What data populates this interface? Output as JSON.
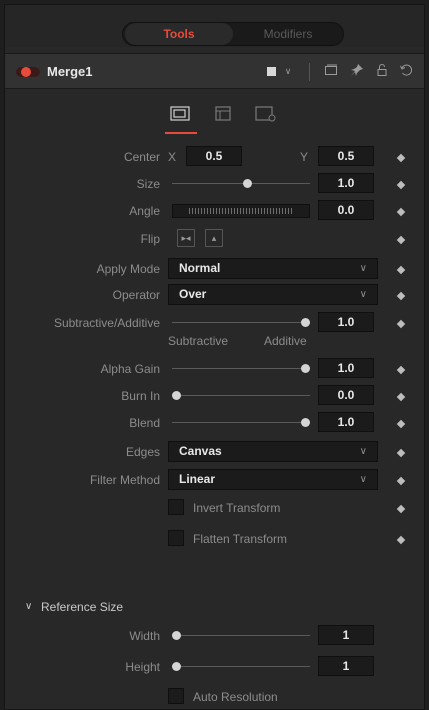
{
  "tabs": {
    "tools": "Tools",
    "modifiers": "Modifiers"
  },
  "tool": {
    "name": "Merge1"
  },
  "icons": {
    "subtabs": [
      "merge-icon",
      "settings-icon",
      "camera-icon"
    ],
    "header": [
      "color-swatch-icon",
      "chevron-down-icon",
      "view-icon",
      "pin-icon",
      "lock-icon",
      "reset-icon"
    ]
  },
  "controls": {
    "center": {
      "label": "Center",
      "x_label": "X",
      "x": "0.5",
      "y_label": "Y",
      "y": "0.5"
    },
    "size": {
      "label": "Size",
      "value": "1.0",
      "fraction": 0.55
    },
    "angle": {
      "label": "Angle",
      "value": "0.0"
    },
    "flip": {
      "label": "Flip"
    },
    "apply_mode": {
      "label": "Apply Mode",
      "value": "Normal"
    },
    "operator": {
      "label": "Operator",
      "value": "Over"
    },
    "subtractive_additive": {
      "label": "Subtractive/Additive",
      "value": "1.0",
      "left_label": "Subtractive",
      "right_label": "Additive",
      "fraction": 1.0
    },
    "alpha_gain": {
      "label": "Alpha Gain",
      "value": "1.0",
      "fraction": 1.0
    },
    "burn_in": {
      "label": "Burn In",
      "value": "0.0",
      "fraction": 0.0
    },
    "blend": {
      "label": "Blend",
      "value": "1.0",
      "fraction": 1.0
    },
    "edges": {
      "label": "Edges",
      "value": "Canvas"
    },
    "filter_method": {
      "label": "Filter Method",
      "value": "Linear"
    },
    "invert_transform": {
      "label": "Invert Transform",
      "checked": false
    },
    "flatten_transform": {
      "label": "Flatten Transform",
      "checked": false
    }
  },
  "reference_size": {
    "title": "Reference Size",
    "width": {
      "label": "Width",
      "value": "1"
    },
    "height": {
      "label": "Height",
      "value": "1"
    },
    "auto_resolution": {
      "label": "Auto Resolution",
      "checked": false
    }
  },
  "colors": {
    "accent": "#e64b3b",
    "panel": "#282829",
    "field": "#1b1b1b"
  }
}
